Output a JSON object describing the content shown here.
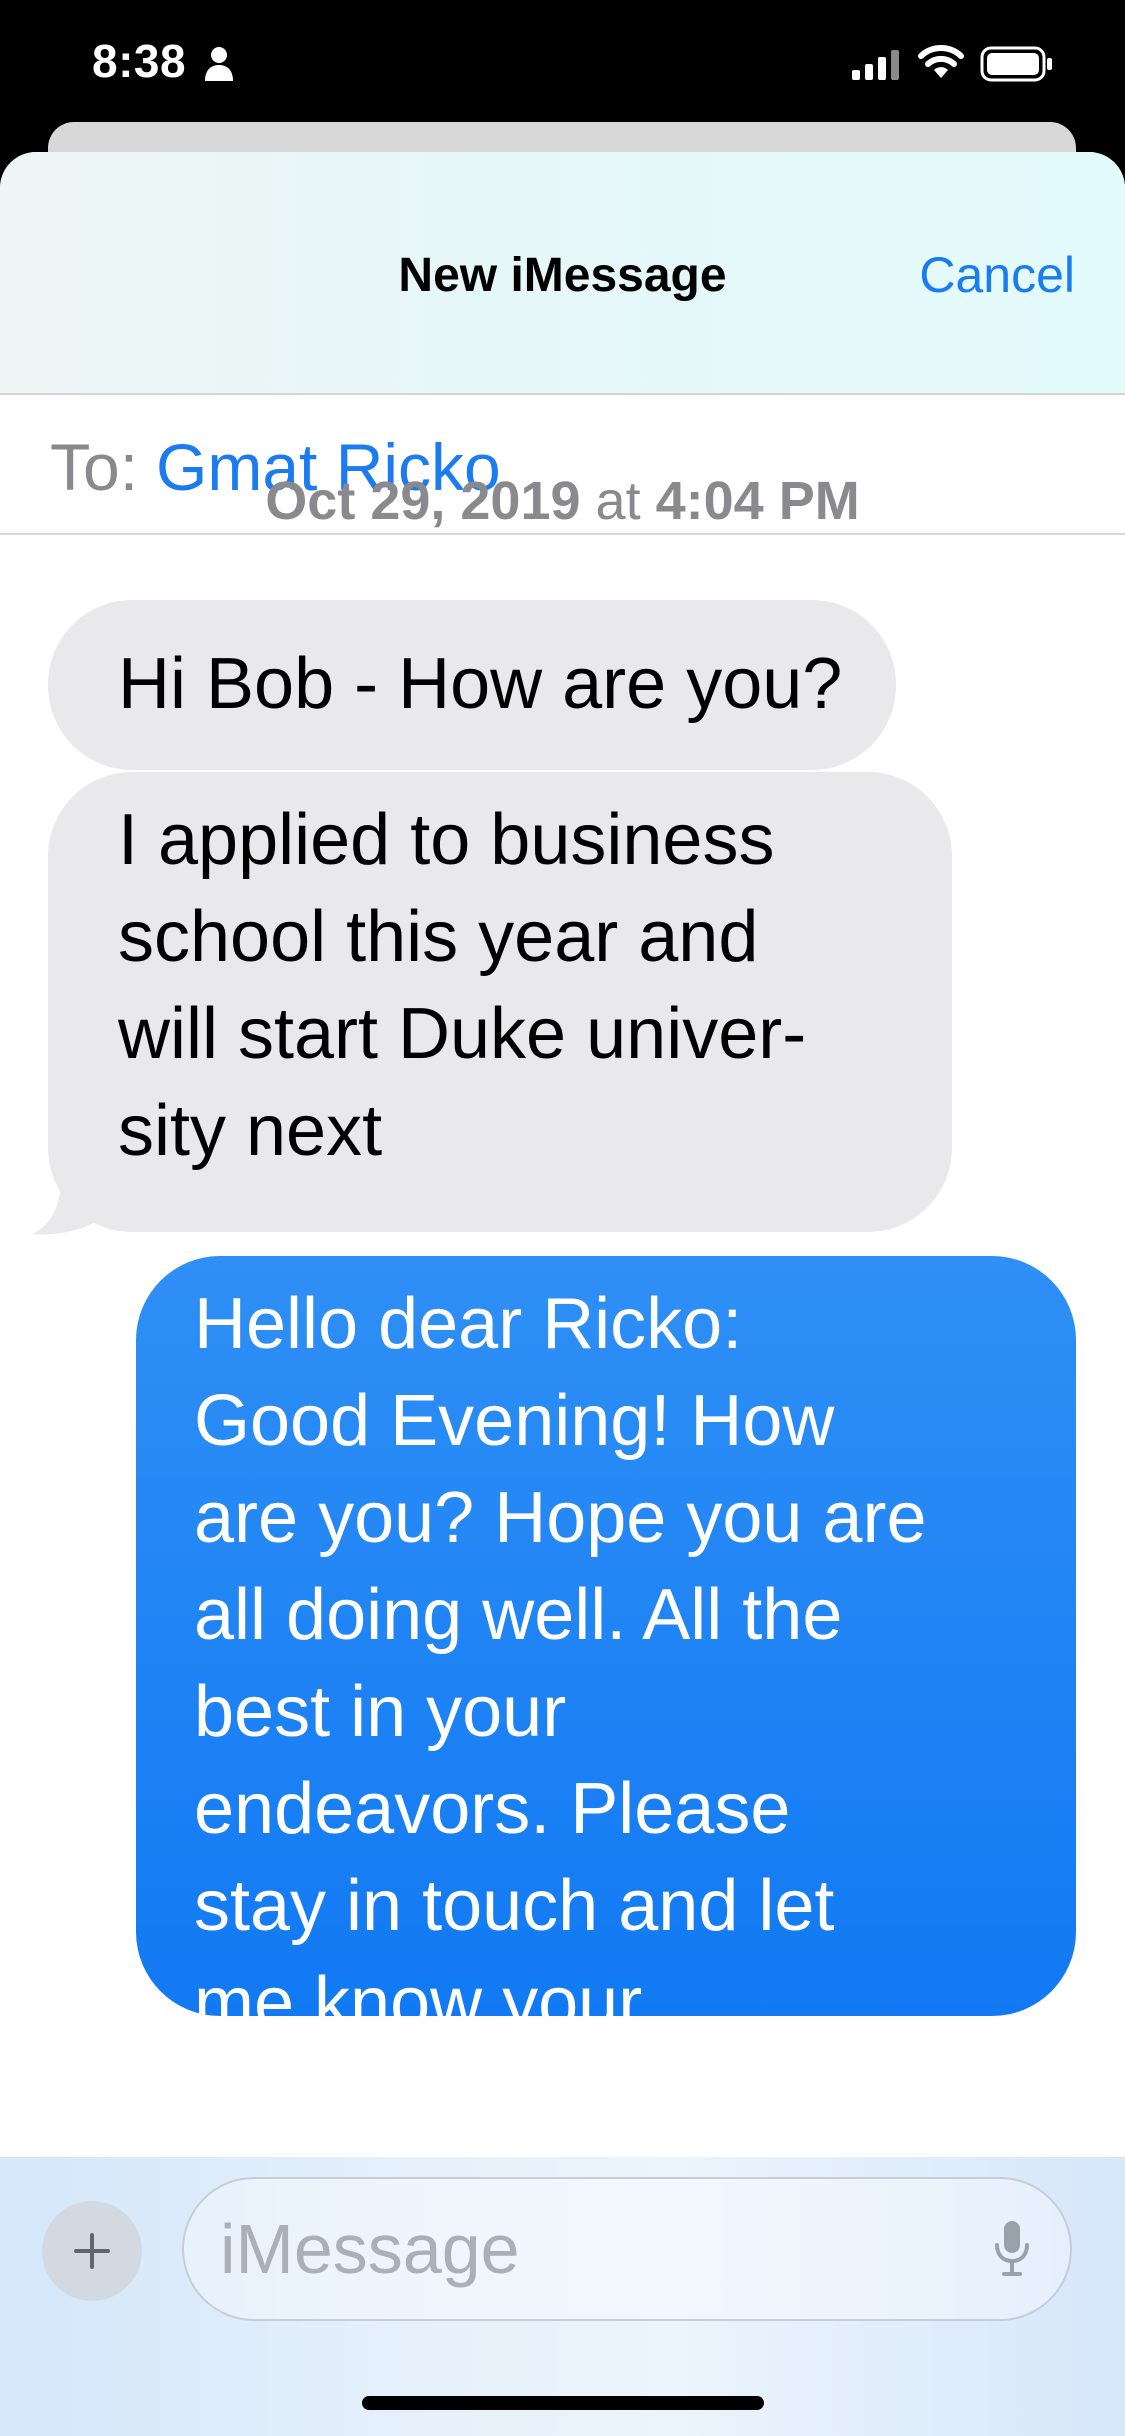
{
  "status_bar": {
    "time": "8:38",
    "icons": [
      "person-icon",
      "cellular-signal-icon",
      "wifi-icon",
      "battery-icon"
    ]
  },
  "header": {
    "title": "New iMessage",
    "cancel_label": "Cancel"
  },
  "recipient": {
    "label": "To:",
    "name": "Gmat Ricko"
  },
  "conversation": {
    "timestamp_date": "Oct 29, 2019",
    "timestamp_at": "at",
    "timestamp_time": "4:04 PM",
    "messages": [
      {
        "direction": "received",
        "text": "Hi Bob - How are you?"
      },
      {
        "direction": "received",
        "lines": [
          "I applied to business",
          "school this year and",
          "will start Duke univer-",
          "sity next"
        ]
      },
      {
        "direction": "sent",
        "lines": [
          "Hello dear Ricko:",
          "Good Evening! How",
          "are you? Hope you are",
          "all doing well. All the",
          "best in your",
          "endeavors. Please",
          "stay in touch and let",
          "me know your"
        ]
      }
    ]
  },
  "composer": {
    "placeholder": "iMessage",
    "icons": [
      "plus-icon",
      "microphone-icon"
    ]
  },
  "colors": {
    "accent": "#1a7cf0",
    "sent_bubble": "#1179f3",
    "received_bubble": "#e9e9eb"
  }
}
